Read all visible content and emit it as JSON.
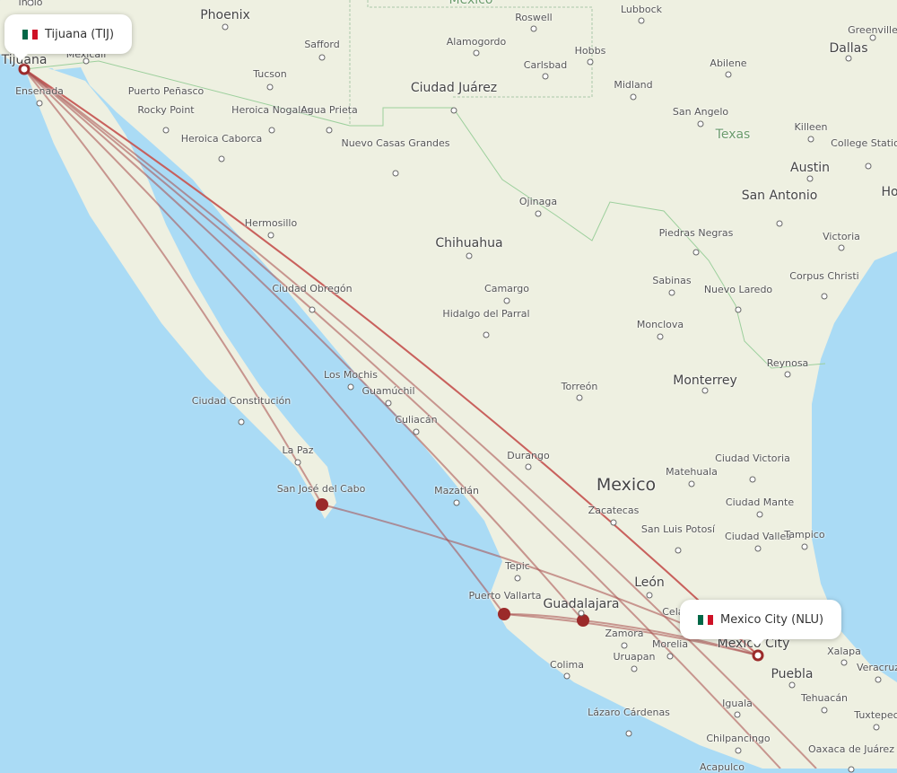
{
  "map": {
    "colors": {
      "ocean": "#aadbf5",
      "land": "#eef0e1",
      "route": "#a84a4a",
      "route_highlight": "#f07068",
      "airport_dot": "#9b2a2a"
    },
    "cities": [
      "Indio",
      "Phoenix",
      "Safford",
      "Tucson",
      "Mexicali",
      "Tijuana",
      "Ensenada",
      "Puerto Peñasco",
      "Rocky Point",
      "Heroica Nogales",
      "Agua Prieta",
      "Heroica Caborca",
      "Roswell",
      "Lubbock",
      "Greenville",
      "Dallas",
      "Alamogordo",
      "Hobbs",
      "Carlsbad",
      "Abilene",
      "Ciudad Juárez",
      "Midland",
      "San Angelo",
      "Killeen",
      "College Station",
      "Nuevo Casas Grandes",
      "Austin",
      "San Antonio",
      "Ojinaga",
      "Hermosillo",
      "Chihuahua",
      "Piedras Negras",
      "Victoria",
      "Sabinas",
      "Nuevo Laredo",
      "Corpus Christi",
      "Ciudad Obregón",
      "Camargo",
      "Hidalgo del Parral",
      "Monclova",
      "Los Mochis",
      "Guamúchil",
      "Torreón",
      "Monterrey",
      "Reynosa",
      "Ciudad Constitución",
      "Culiacán",
      "La Paz",
      "Durango",
      "Matehuala",
      "Ciudad Victoria",
      "San José del Cabo",
      "Mazatlán",
      "Zacatecas",
      "Ciudad Mante",
      "San Luis Potosí",
      "Ciudad Valles",
      "Tampico",
      "Tepic",
      "León",
      "Puerto Vallarta",
      "Guadalajara",
      "Zamora",
      "Morelia",
      "Uruapan",
      "Colima",
      "Xalapa",
      "Veracruz",
      "Puebla",
      "Tehuacán",
      "Iguala",
      "Lázaro Cárdenas",
      "Tuxtepec",
      "Chilpancingo",
      "Oaxaca de Juárez",
      "Acapulco",
      "Mexico City",
      "Celaya",
      "Ho"
    ],
    "regions": [
      "México",
      "Texas",
      "Mexico"
    ]
  },
  "origin": {
    "label": "Tijuana (TIJ)",
    "flag": "mexico-flag"
  },
  "destination": {
    "label": "Mexico City (NLU)",
    "flag": "mexico-flag"
  },
  "airports": [
    "Tijuana",
    "Mexico City",
    "San José del Cabo",
    "Puerto Vallarta",
    "Guadalajara"
  ]
}
